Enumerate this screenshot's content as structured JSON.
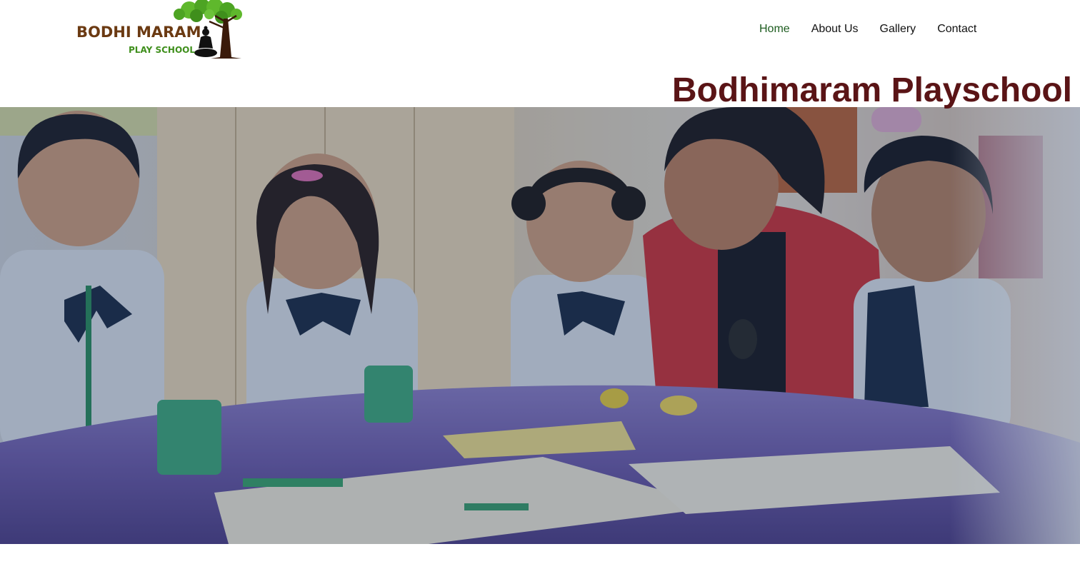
{
  "header": {
    "logo": {
      "line1": "BODHI MARAM",
      "line2": "PLAY SCHOOL",
      "colors": {
        "brown": "#6b3a12",
        "green": "#3f8f1c",
        "leaf": "#5fb82c"
      }
    },
    "nav": [
      {
        "label": "Home",
        "active": true
      },
      {
        "label": "About Us",
        "active": false
      },
      {
        "label": "Gallery",
        "active": false
      },
      {
        "label": "Contact",
        "active": false
      }
    ]
  },
  "hero": {
    "title": "Bodhimaram Playschool",
    "image_subject": "teacher-with-children-playing-clay",
    "colors": {
      "title": "#5a1416",
      "nav_active": "#1d5c1f",
      "overlay": "#162e54",
      "table": "#6b5aa8",
      "uniform": "#d7dde6",
      "bowtie": "#1d2c46",
      "teacher_dress": "#c8323a"
    }
  }
}
